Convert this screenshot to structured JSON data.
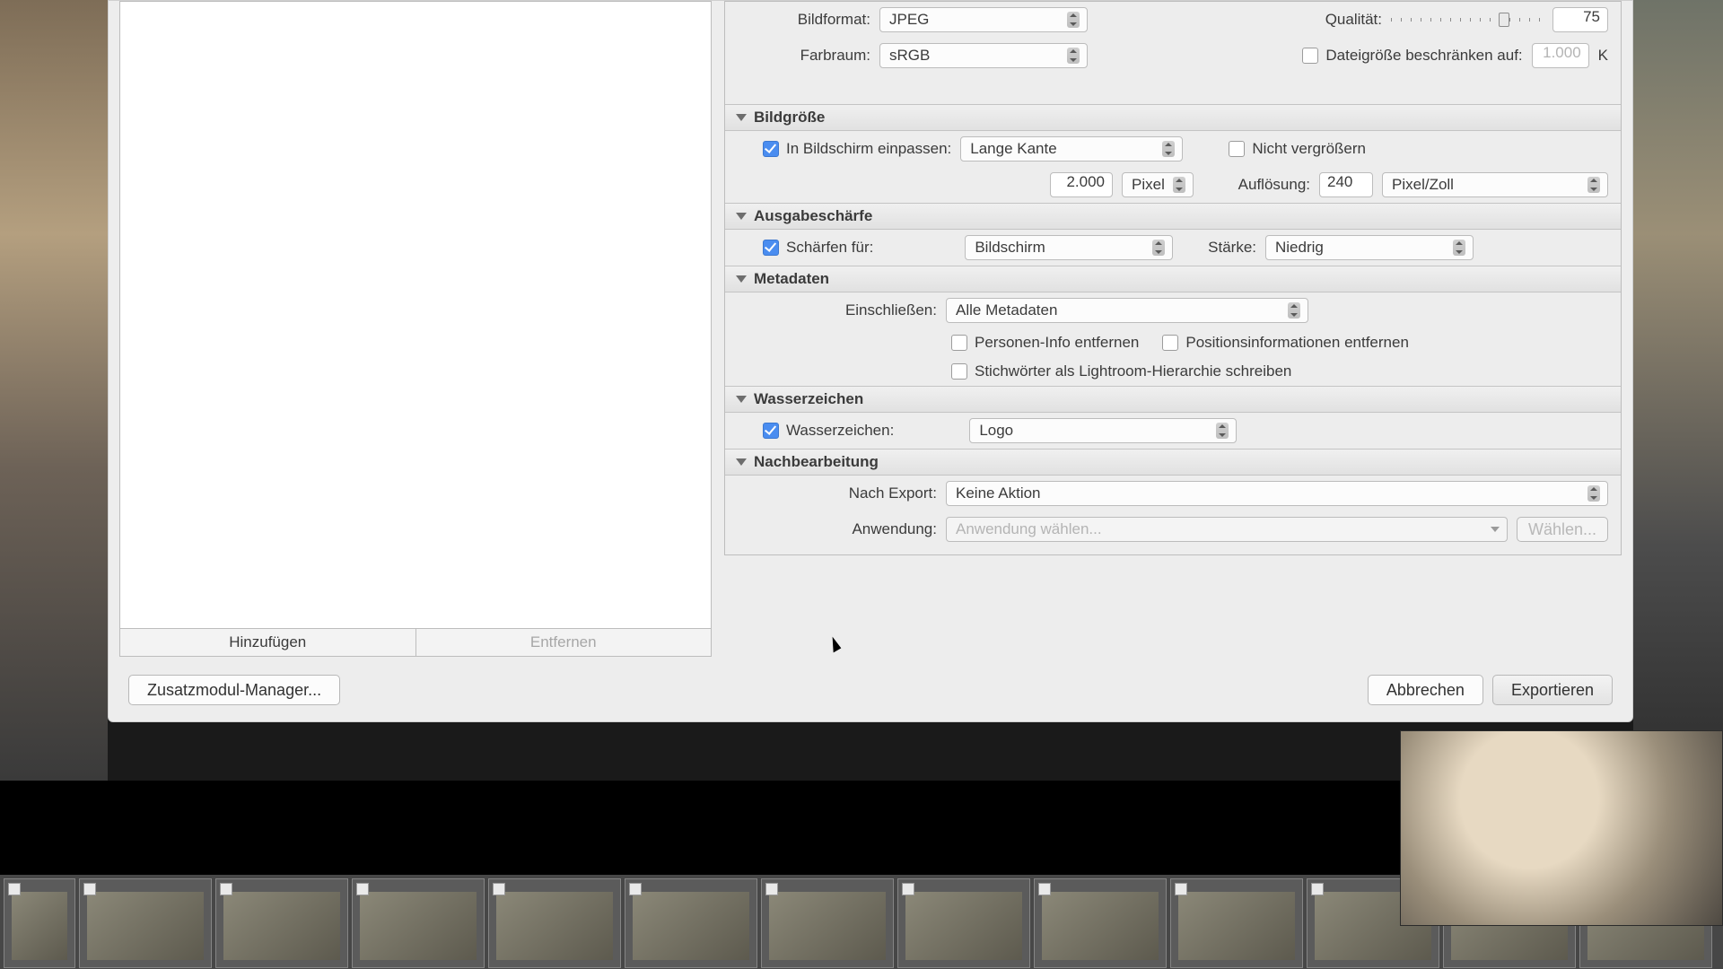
{
  "fileSettings": {
    "format_label": "Bildformat:",
    "format_value": "JPEG",
    "quality_label": "Qualität:",
    "quality_value": "75",
    "colorspace_label": "Farbraum:",
    "colorspace_value": "sRGB",
    "limit_label": "Dateigröße beschränken auf:",
    "limit_value_placeholder": "1.000",
    "limit_unit": "K"
  },
  "imageSizing": {
    "title": "Bildgröße",
    "fit_label": "In Bildschirm einpassen:",
    "fit_value": "Lange Kante",
    "no_enlarge": "Nicht vergrößern",
    "dim_value": "2.000",
    "dim_unit": "Pixel",
    "res_label": "Auflösung:",
    "res_value": "240",
    "res_unit": "Pixel/Zoll"
  },
  "sharpening": {
    "title": "Ausgabeschärfe",
    "for_label": "Schärfen für:",
    "for_value": "Bildschirm",
    "amount_label": "Stärke:",
    "amount_value": "Niedrig"
  },
  "metadata": {
    "title": "Metadaten",
    "include_label": "Einschließen:",
    "include_value": "Alle Metadaten",
    "remove_person": "Personen-Info entfernen",
    "remove_location": "Positionsinformationen entfernen",
    "keyword_hierarchy": "Stichwörter als Lightroom-Hierarchie schreiben"
  },
  "watermark": {
    "title": "Wasserzeichen",
    "label": "Wasserzeichen:",
    "value": "Logo"
  },
  "post": {
    "title": "Nachbearbeitung",
    "after_label": "Nach Export:",
    "after_value": "Keine Aktion",
    "app_label": "Anwendung:",
    "app_placeholder": "Anwendung wählen...",
    "choose": "Wählen..."
  },
  "presets": {
    "add": "Hinzufügen",
    "remove": "Entfernen"
  },
  "footer": {
    "plugin": "Zusatzmodul-Manager...",
    "cancel": "Abbrechen",
    "export": "Exportieren"
  }
}
